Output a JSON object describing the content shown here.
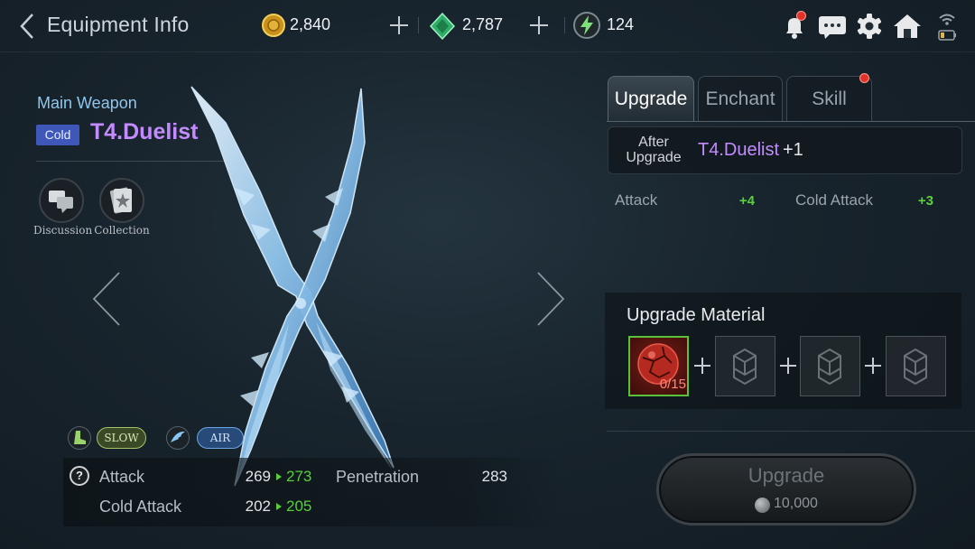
{
  "header": {
    "title": "Equipment Info",
    "currencies": [
      {
        "icon": "gold-coin-icon",
        "value": "2,840"
      },
      {
        "icon": "green-gem-icon",
        "value": "2,787"
      },
      {
        "icon": "energy-icon",
        "value": "124"
      }
    ],
    "icons": [
      "bell-icon",
      "chat-icon",
      "gear-icon",
      "home-icon",
      "wifi-battery-icon"
    ]
  },
  "item": {
    "slot": "Main Weapon",
    "element": "Cold",
    "name": "T4.Duelist",
    "actions": [
      {
        "label": "Discussion",
        "icon": "discussion-icon"
      },
      {
        "label": "Collection",
        "icon": "collection-icon"
      }
    ],
    "traits": [
      {
        "label": "SLOW",
        "icon": "boot-icon"
      },
      {
        "label": "AIR",
        "icon": "wing-icon"
      }
    ],
    "stats": [
      {
        "name": "Attack",
        "current": "269",
        "next": "273"
      },
      {
        "name": "Cold Attack",
        "current": "202",
        "next": "205"
      },
      {
        "name": "Penetration",
        "current": "283"
      }
    ]
  },
  "tabs": [
    {
      "label": "Upgrade",
      "active": true
    },
    {
      "label": "Enchant",
      "active": false
    },
    {
      "label": "Skill",
      "active": false,
      "notification": true
    }
  ],
  "upgrade": {
    "after_label": "After Upgrade",
    "after_label_line1": "After",
    "after_label_line2": "Upgrade",
    "after_name": "T4.Duelist",
    "after_suffix": "+1",
    "bonuses": [
      {
        "name": "Attack",
        "value": "+4"
      },
      {
        "name": "Cold Attack",
        "value": "+3"
      }
    ],
    "material_title": "Upgrade Material",
    "materials": [
      {
        "icon": "red-ore-icon",
        "count": "0/15"
      },
      {
        "icon": "empty-material-icon"
      },
      {
        "icon": "empty-material-icon"
      },
      {
        "icon": "empty-material-icon"
      }
    ],
    "button_label": "Upgrade",
    "cost": "10,000"
  },
  "colors": {
    "item_name": "#c48bff",
    "bonus_green": "#56d03a",
    "slot_label": "#8fc6ee",
    "element_badge": "#3f57b8"
  }
}
